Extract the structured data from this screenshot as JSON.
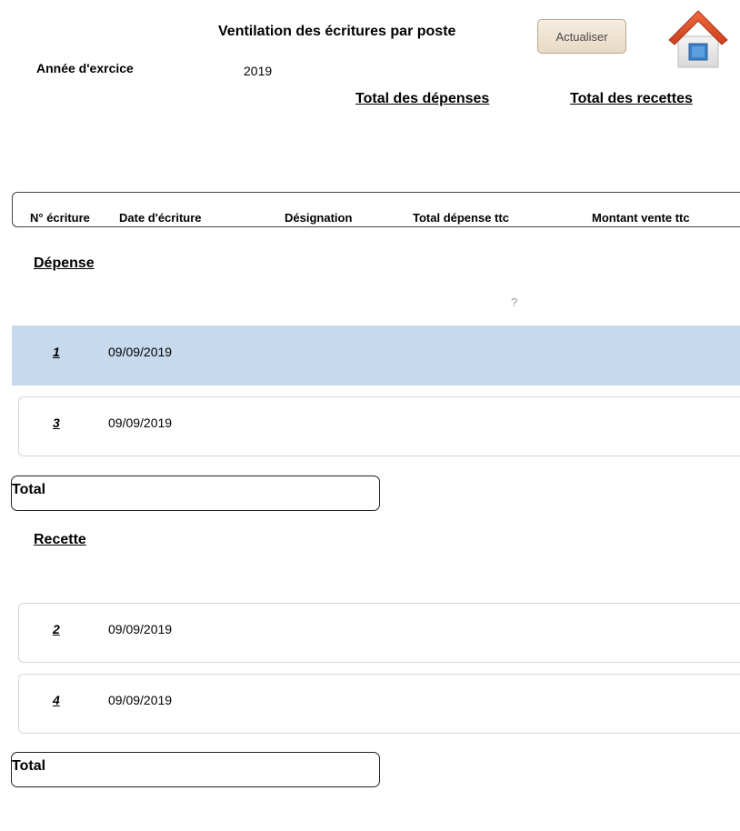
{
  "header": {
    "title": "Ventilation des écritures par poste",
    "refresh_label": "Actualiser",
    "year_label": "Année d'exrcice",
    "year_value": "2019",
    "total_expenses_label": "Total des dépenses",
    "total_receipts_label": "Total des recettes"
  },
  "table": {
    "columns": [
      "N° écriture",
      "Date d'écriture",
      "Désignation",
      "Total dépense ttc",
      "Montant vente ttc"
    ]
  },
  "depense": {
    "section_label": "Dépense",
    "placeholder": "?",
    "rows": [
      {
        "num": "1",
        "date": "09/09/2019"
      },
      {
        "num": "3",
        "date": "09/09/2019"
      }
    ],
    "total_label": "Total"
  },
  "recette": {
    "section_label": "Recette",
    "rows": [
      {
        "num": "2",
        "date": "09/09/2019"
      },
      {
        "num": "4",
        "date": "09/09/2019"
      }
    ],
    "total_label": "Total"
  },
  "colors": {
    "selected_row": "#c7daed",
    "home_roof": "#e2552f",
    "home_window": "#3b7fc4"
  },
  "icons": {
    "home": "home-icon"
  }
}
